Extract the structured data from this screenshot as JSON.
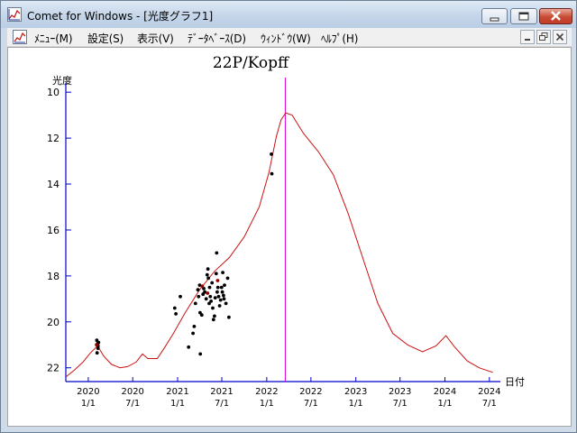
{
  "window": {
    "title": "Comet for Windows - [光度グラフ1]"
  },
  "menu": {
    "items": [
      "ﾒﾆｭｰ(M)",
      "設定(S)",
      "表示(V)",
      "ﾃﾞｰﾀﾍﾞｰｽ(D)",
      "ｳｨﾝﾄﾞｳ(W)",
      "ﾍﾙﾌﾟ(H)"
    ]
  },
  "icons": {
    "app": "graph-icon",
    "document": "graph-icon",
    "caption": [
      "minimize-icon",
      "maximize-icon",
      "close-icon"
    ],
    "mdi": [
      "minimize-icon",
      "restore-icon",
      "close-icon"
    ]
  },
  "colors": {
    "curve": "#cc1111",
    "axis": "#0000cc",
    "perihelion_marker": "#dd00dd",
    "observations": "#000000",
    "observations_secondary": "#990000",
    "ticklabels": "#000000"
  },
  "chart_data": {
    "type": "line",
    "title": "22P/Kopff",
    "ylabel": "光度",
    "xlabel": "日付",
    "y_inverted": true,
    "ylim": [
      22.6,
      9.6
    ],
    "xlim": [
      "2019-10-01",
      "2024-08-15"
    ],
    "yticks": [
      10,
      12,
      14,
      16,
      18,
      20,
      22
    ],
    "xticks": [
      {
        "date": "2020-01-01",
        "year": "2020",
        "md": "1/1"
      },
      {
        "date": "2020-07-01",
        "year": "2020",
        "md": "7/1"
      },
      {
        "date": "2021-01-01",
        "year": "2021",
        "md": "1/1"
      },
      {
        "date": "2021-07-01",
        "year": "2021",
        "md": "7/1"
      },
      {
        "date": "2022-01-01",
        "year": "2022",
        "md": "1/1"
      },
      {
        "date": "2022-07-01",
        "year": "2022",
        "md": "7/1"
      },
      {
        "date": "2023-01-01",
        "year": "2023",
        "md": "1/1"
      },
      {
        "date": "2023-07-01",
        "year": "2023",
        "md": "7/1"
      },
      {
        "date": "2024-01-01",
        "year": "2024",
        "md": "1/1"
      },
      {
        "date": "2024-07-01",
        "year": "2024",
        "md": "7/1"
      }
    ],
    "grid": false,
    "perihelion_date": "2022-03-18",
    "series": [
      {
        "kind": "predicted",
        "points": [
          [
            "2019-10-01",
            22.4
          ],
          [
            "2019-11-05",
            22.1
          ],
          [
            "2019-12-10",
            21.75
          ],
          [
            "2020-01-10",
            21.35
          ],
          [
            "2020-02-08",
            21.05
          ],
          [
            "2020-03-05",
            21.5
          ],
          [
            "2020-04-05",
            21.85
          ],
          [
            "2020-05-10",
            22.0
          ],
          [
            "2020-06-10",
            21.95
          ],
          [
            "2020-07-15",
            21.75
          ],
          [
            "2020-08-10",
            21.4
          ],
          [
            "2020-09-01",
            21.6
          ],
          [
            "2020-10-10",
            21.6
          ],
          [
            "2020-11-10",
            21.1
          ],
          [
            "2020-12-15",
            20.5
          ],
          [
            "2021-02-01",
            19.6
          ],
          [
            "2021-04-01",
            18.6
          ],
          [
            "2021-06-01",
            17.8
          ],
          [
            "2021-08-01",
            17.2
          ],
          [
            "2021-10-01",
            16.3
          ],
          [
            "2021-12-01",
            15.0
          ],
          [
            "2022-01-10",
            13.5
          ],
          [
            "2022-02-10",
            11.9
          ],
          [
            "2022-03-01",
            11.2
          ],
          [
            "2022-03-20",
            10.9
          ],
          [
            "2022-04-15",
            11.0
          ],
          [
            "2022-06-01",
            11.8
          ],
          [
            "2022-08-01",
            12.6
          ],
          [
            "2022-10-01",
            13.6
          ],
          [
            "2022-12-01",
            15.3
          ],
          [
            "2023-02-01",
            17.3
          ],
          [
            "2023-04-01",
            19.2
          ],
          [
            "2023-06-01",
            20.5
          ],
          [
            "2023-08-01",
            21.0
          ],
          [
            "2023-10-01",
            21.3
          ],
          [
            "2023-11-25",
            21.05
          ],
          [
            "2024-01-05",
            20.6
          ],
          [
            "2024-02-10",
            21.1
          ],
          [
            "2024-04-01",
            21.7
          ],
          [
            "2024-05-20",
            22.0
          ],
          [
            "2024-07-15",
            22.2
          ]
        ]
      },
      {
        "kind": "observed",
        "points": [
          [
            "2020-02-05",
            20.8
          ],
          [
            "2020-02-08",
            20.95
          ],
          [
            "2020-02-10",
            21.15
          ],
          [
            "2020-02-06",
            21.35
          ],
          [
            "2020-02-12",
            20.9
          ],
          [
            "2020-02-10",
            21.05
          ],
          [
            "2020-12-20",
            19.4
          ],
          [
            "2020-12-25",
            19.65
          ],
          [
            "2021-01-12",
            18.9
          ],
          [
            "2021-02-15",
            21.1
          ],
          [
            "2021-03-05",
            20.5
          ],
          [
            "2021-03-10",
            20.2
          ],
          [
            "2021-03-15",
            19.2
          ],
          [
            "2021-03-25",
            18.6
          ],
          [
            "2021-03-28",
            18.9
          ],
          [
            "2021-04-01",
            18.4
          ],
          [
            "2021-04-03",
            19.6
          ],
          [
            "2021-04-04",
            21.4
          ],
          [
            "2021-04-10",
            19.7
          ],
          [
            "2021-04-15",
            18.8
          ],
          [
            "2021-04-18",
            18.55
          ],
          [
            "2021-04-22",
            18.7
          ],
          [
            "2021-04-28",
            19.0
          ],
          [
            "2021-05-02",
            17.95
          ],
          [
            "2021-05-05",
            17.7
          ],
          [
            "2021-05-07",
            18.1
          ],
          [
            "2021-05-10",
            19.2
          ],
          [
            "2021-05-12",
            18.5
          ],
          [
            "2021-05-15",
            18.9
          ],
          [
            "2021-05-18",
            19.1
          ],
          [
            "2021-05-22",
            18.3
          ],
          [
            "2021-05-25",
            19.4
          ],
          [
            "2021-05-28",
            19.9
          ],
          [
            "2021-06-01",
            19.75
          ],
          [
            "2021-06-04",
            18.95
          ],
          [
            "2021-06-08",
            17.9
          ],
          [
            "2021-06-10",
            17.0
          ],
          [
            "2021-06-12",
            18.7
          ],
          [
            "2021-06-15",
            18.5
          ],
          [
            "2021-06-18",
            18.9
          ],
          [
            "2021-06-22",
            19.3
          ],
          [
            "2021-06-26",
            19.05
          ],
          [
            "2021-06-30",
            18.5
          ],
          [
            "2021-07-03",
            18.7
          ],
          [
            "2021-07-05",
            17.85
          ],
          [
            "2021-07-08",
            18.85
          ],
          [
            "2021-07-10",
            19.0
          ],
          [
            "2021-07-12",
            18.4
          ],
          [
            "2021-07-18",
            19.2
          ],
          [
            "2021-07-25",
            18.1
          ],
          [
            "2021-07-30",
            19.8
          ],
          [
            "2022-01-20",
            12.7
          ],
          [
            "2022-01-22",
            13.55
          ]
        ]
      },
      {
        "kind": "observed-secondary",
        "points": [
          [
            "2020-02-04",
            21.0
          ],
          [
            "2021-04-12",
            18.45
          ],
          [
            "2021-05-04",
            18.75
          ],
          [
            "2021-06-14",
            18.2
          ]
        ]
      }
    ]
  }
}
